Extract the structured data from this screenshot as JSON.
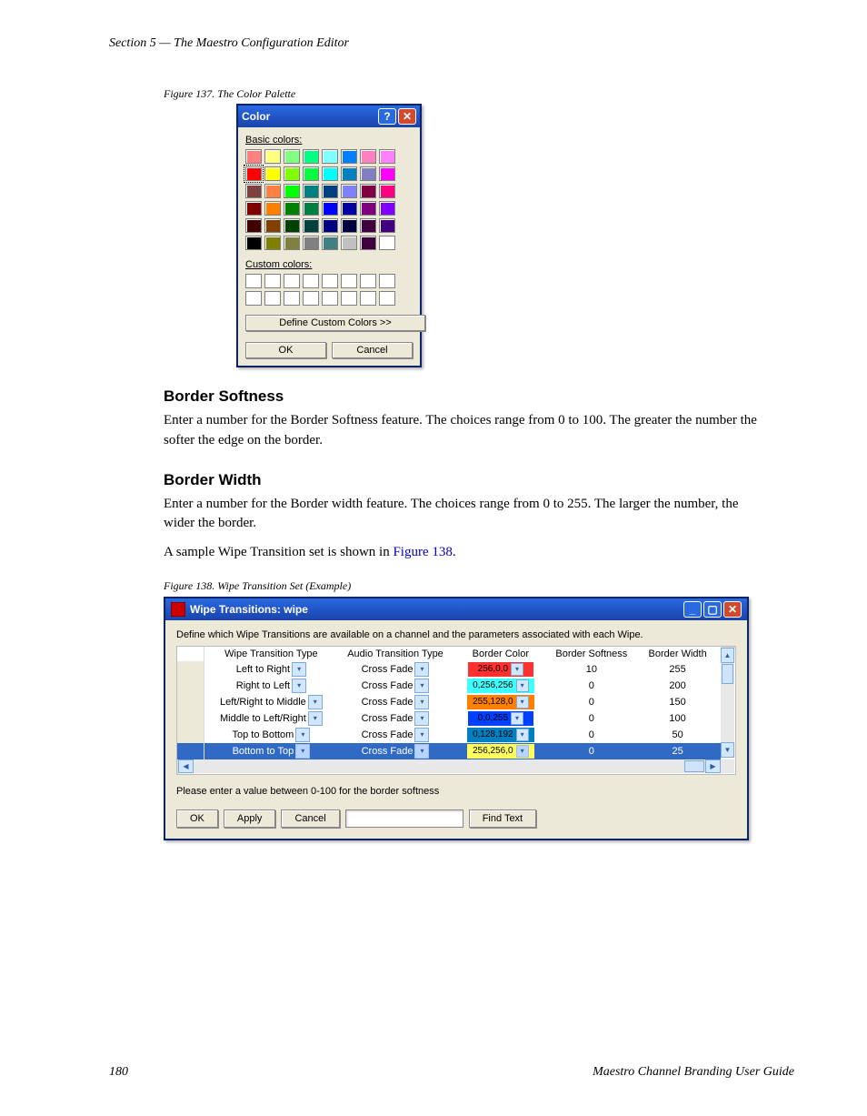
{
  "header": {
    "running_title": "Section 5 — The Maestro Configuration Editor"
  },
  "fig137": {
    "caption": "Figure 137.  The Color Palette",
    "title": "Color",
    "basic_label": "Basic colors:",
    "custom_label": "Custom colors:",
    "define_btn": "Define Custom Colors >>",
    "ok": "OK",
    "cancel": "Cancel",
    "basic_colors": [
      [
        "#ff8080",
        "#ffff80",
        "#80ff80",
        "#00ff80",
        "#80ffff",
        "#0080ff",
        "#ff80c0",
        "#ff80ff"
      ],
      [
        "#ff0000",
        "#ffff00",
        "#80ff00",
        "#00ff40",
        "#00ffff",
        "#0080c0",
        "#8080c0",
        "#ff00ff"
      ],
      [
        "#804040",
        "#ff8040",
        "#00ff00",
        "#008080",
        "#004080",
        "#8080ff",
        "#800040",
        "#ff0080"
      ],
      [
        "#800000",
        "#ff8000",
        "#008000",
        "#008040",
        "#0000ff",
        "#0000a0",
        "#800080",
        "#8000ff"
      ],
      [
        "#400000",
        "#804000",
        "#004000",
        "#004040",
        "#000080",
        "#000040",
        "#400040",
        "#400080"
      ],
      [
        "#000000",
        "#808000",
        "#808040",
        "#808080",
        "#408080",
        "#c0c0c0",
        "#400040",
        "#ffffff"
      ]
    ]
  },
  "sections": {
    "softness": {
      "title": "Border Softness",
      "body": "Enter a number for the Border Softness feature. The choices range from 0 to 100. The greater the number the softer the edge on the border."
    },
    "width": {
      "title": "Border Width",
      "body": "Enter a number for the Border width feature. The choices range from 0 to 255. The larger the number, the wider the border.",
      "sample_prefix": "A sample Wipe Transition set is shown in ",
      "sample_link": "Figure 138",
      "sample_suffix": "."
    }
  },
  "fig138": {
    "caption": "Figure 138.  Wipe Transition Set (Example)",
    "title": "Wipe Transitions: wipe",
    "instruct": "Define which Wipe Transitions are available on a channel and the parameters associated with each Wipe.",
    "cols": [
      "Wipe Transition Type",
      "Audio Transition Type",
      "Border Color",
      "Border Softness",
      "Border Width"
    ],
    "rows": [
      {
        "wipe": "Left to Right",
        "audio": "Cross Fade",
        "color_txt": "256,0,0",
        "color_bg": "#ff3030",
        "softness": "10",
        "width": "255"
      },
      {
        "wipe": "Right to Left",
        "audio": "Cross Fade",
        "color_txt": "0,256,256",
        "color_bg": "#40ffff",
        "softness": "0",
        "width": "200"
      },
      {
        "wipe": "Left/Right to Middle",
        "audio": "Cross Fade",
        "color_txt": "255,128,0",
        "color_bg": "#ff8000",
        "softness": "0",
        "width": "150"
      },
      {
        "wipe": "Middle to Left/Right",
        "audio": "Cross Fade",
        "color_txt": "0,0,255",
        "color_bg": "#0040ff",
        "softness": "0",
        "width": "100"
      },
      {
        "wipe": "Top to Bottom",
        "audio": "Cross Fade",
        "color_txt": "0,128,192",
        "color_bg": "#0080c0",
        "softness": "0",
        "width": "50"
      },
      {
        "wipe": "Bottom to Top",
        "audio": "Cross Fade",
        "color_txt": "256,256,0",
        "color_bg": "#ffff60",
        "softness": "0",
        "width": "25",
        "selected": true
      }
    ],
    "help": "Please enter a value between 0-100 for the border softness",
    "buttons": {
      "ok": "OK",
      "apply": "Apply",
      "cancel": "Cancel",
      "find": "Find Text"
    }
  },
  "footer": {
    "page": "180",
    "doc": "Maestro Channel Branding User Guide"
  }
}
